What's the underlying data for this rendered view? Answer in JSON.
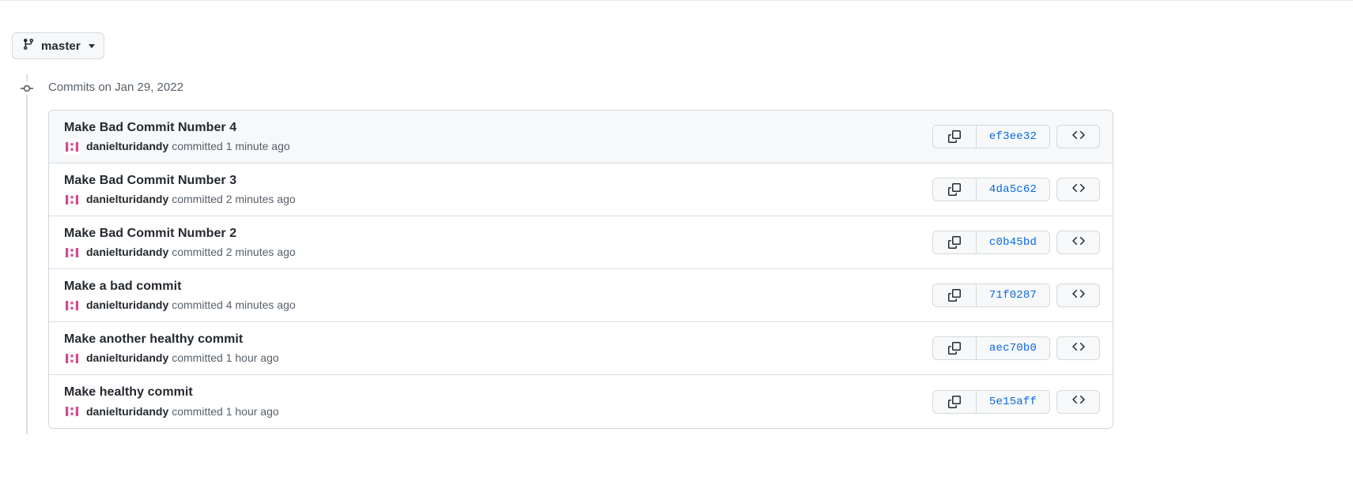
{
  "branch_selector": {
    "label": "master",
    "icon": "git-branch-icon",
    "caret_icon": "chevron-down-icon"
  },
  "timeline": {
    "node_icon": "commit-node-icon",
    "date_header": "Commits on Jan 29, 2022"
  },
  "colors": {
    "link_blue": "#0969da",
    "text_primary": "#24292f",
    "text_muted": "#57606a",
    "border": "#d0d7de",
    "row_highlight": "#f6f8fa",
    "avatar_pink": "#cf4b8f"
  },
  "actions": {
    "copy_icon": "copy-icon",
    "code_icon": "code-angle-brackets-icon"
  },
  "commits": [
    {
      "title": "Make Bad Commit Number 4",
      "author": "danielturidandy",
      "committed": "committed 1 minute ago",
      "sha": "ef3ee32",
      "highlighted": true
    },
    {
      "title": "Make Bad Commit Number 3",
      "author": "danielturidandy",
      "committed": "committed 2 minutes ago",
      "sha": "4da5c62",
      "highlighted": false
    },
    {
      "title": "Make Bad Commit Number 2",
      "author": "danielturidandy",
      "committed": "committed 2 minutes ago",
      "sha": "c0b45bd",
      "highlighted": false
    },
    {
      "title": "Make a bad commit",
      "author": "danielturidandy",
      "committed": "committed 4 minutes ago",
      "sha": "71f0287",
      "highlighted": false
    },
    {
      "title": "Make another healthy commit",
      "author": "danielturidandy",
      "committed": "committed 1 hour ago",
      "sha": "aec70b0",
      "highlighted": false
    },
    {
      "title": "Make healthy commit",
      "author": "danielturidandy",
      "committed": "committed 1 hour ago",
      "sha": "5e15aff",
      "highlighted": false
    }
  ]
}
